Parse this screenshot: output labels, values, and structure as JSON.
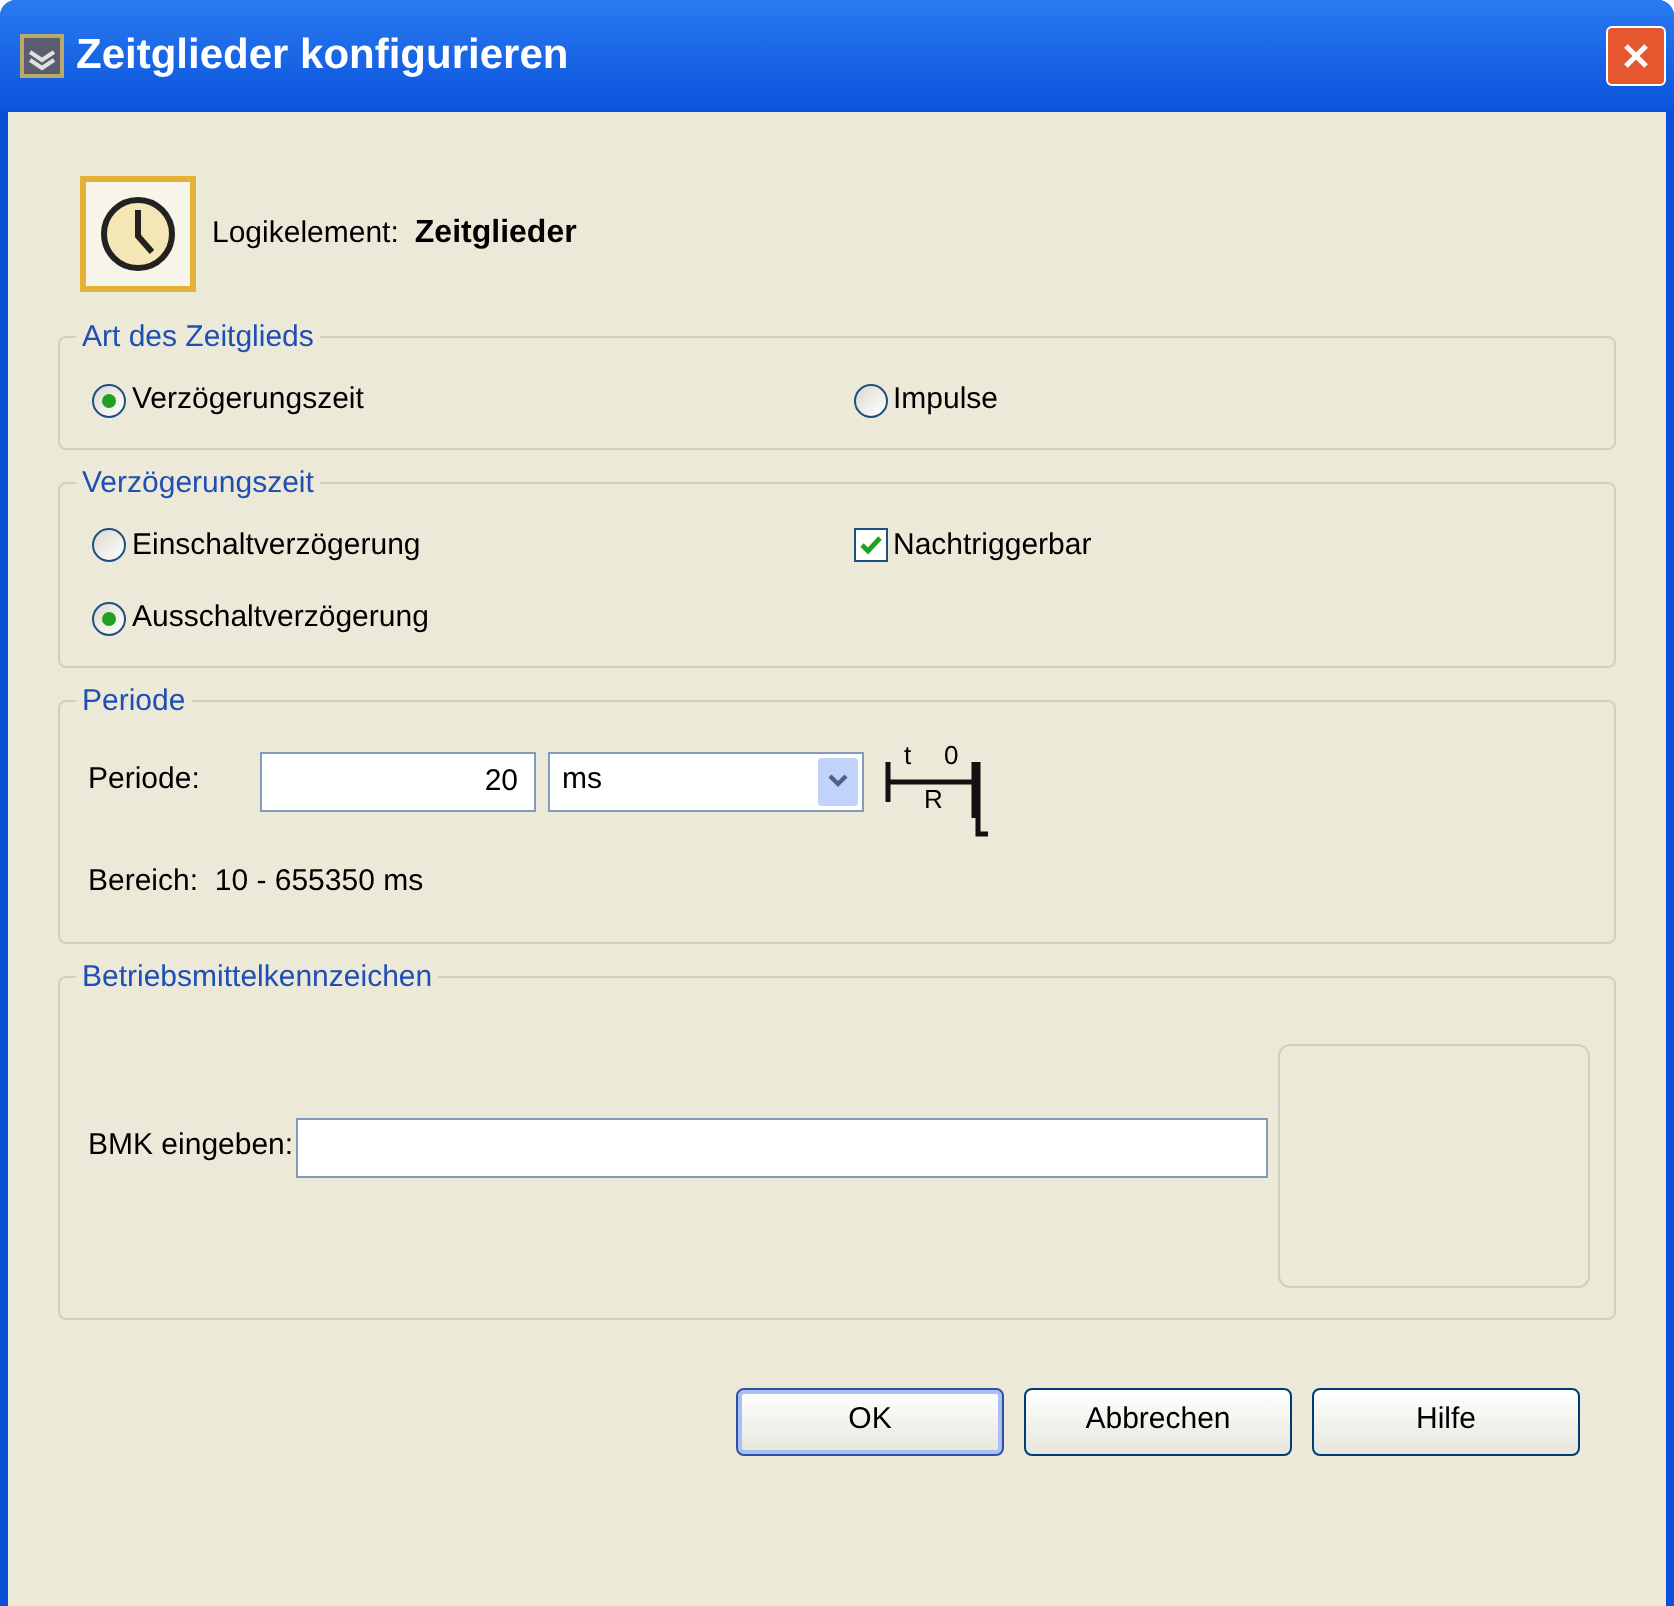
{
  "window": {
    "title": "Zeitglieder konfigurieren"
  },
  "element": {
    "label": "Logikelement:",
    "value": "Zeitglieder"
  },
  "option_groups": [
    {
      "title": "Art des Zeitglieds",
      "items": [
        {
          "kind": "radio",
          "label": "Verzögerungszeit",
          "selected": true
        },
        {
          "kind": "radio",
          "label": "Impulse",
          "selected": false
        }
      ]
    },
    {
      "title": "Verzögerungszeit",
      "items": [
        {
          "kind": "radio",
          "label": "Einschaltverzögerung",
          "selected": false
        },
        {
          "kind": "checkbox",
          "label": "Nachtriggerbar",
          "checked": true
        },
        {
          "kind": "radio",
          "label": "Ausschaltverzögerung",
          "selected": true
        }
      ]
    }
  ],
  "period": {
    "title": "Periode",
    "label": "Periode:",
    "value": "20",
    "unit": "ms",
    "symbol": [
      "t",
      "0",
      "R"
    ],
    "range": "Bereich:  10 - 655350 ms"
  },
  "bmk": {
    "title": "Betriebsmittelkennzeichen",
    "label": "BMK eingeben:"
  },
  "buttons": [
    {
      "label": "OK",
      "default": true
    },
    {
      "label": "Abbrechen",
      "default": false
    },
    {
      "label": "Hilfe",
      "default": false
    }
  ]
}
